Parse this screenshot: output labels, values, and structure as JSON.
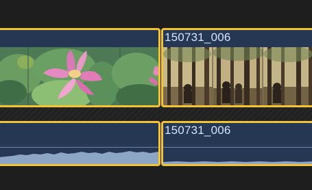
{
  "timeline": {
    "clips": [
      {
        "kind": "video",
        "title": "",
        "frames": "lotus"
      },
      {
        "kind": "video",
        "title": "150731_006",
        "frames": "forest"
      },
      {
        "kind": "audio",
        "title": ""
      },
      {
        "kind": "audio",
        "title": "150731_006"
      }
    ]
  },
  "colors": {
    "background": "#1e1e1f",
    "selection_border": "#f4c430",
    "clip_fill": "#253753",
    "title_text": "#d6e6ff",
    "waveform": "#8ea6c6"
  }
}
